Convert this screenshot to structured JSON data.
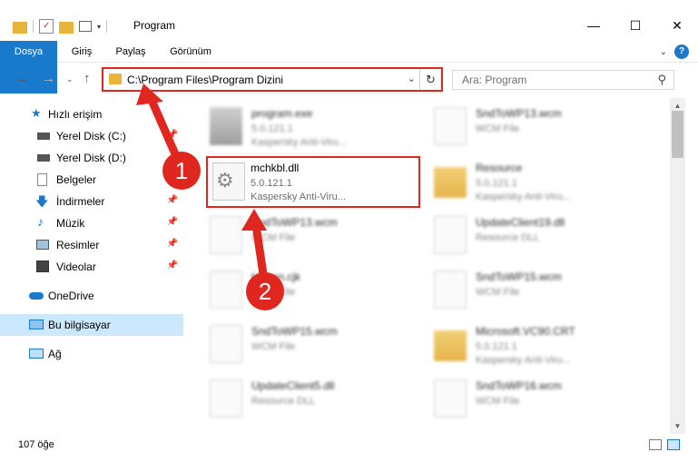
{
  "window": {
    "title": "Program"
  },
  "ribbon": {
    "tabs": [
      "Dosya",
      "Giriş",
      "Paylaş",
      "Görünüm"
    ]
  },
  "address": {
    "path": "C:\\Program Files\\Program Dizini"
  },
  "search": {
    "placeholder": "Ara: Program"
  },
  "sidebar": {
    "items": [
      {
        "label": "Hızlı erişim"
      },
      {
        "label": "Yerel Disk (C:)"
      },
      {
        "label": "Yerel Disk (D:)"
      },
      {
        "label": "Belgeler"
      },
      {
        "label": "İndirmeler"
      },
      {
        "label": "Müzik"
      },
      {
        "label": "Resimler"
      },
      {
        "label": "Videolar"
      },
      {
        "label": "OneDrive"
      },
      {
        "label": "Bu bilgisayar"
      },
      {
        "label": "Ağ"
      }
    ]
  },
  "files": [
    {
      "name": "program.exe",
      "line1": "5.0.121.1",
      "line2": "Kaspersky Anti-Viru..."
    },
    {
      "name": "SndToWP13.wcm",
      "line1": "WCM File",
      "line2": ""
    },
    {
      "name": "Resource",
      "line1": "5.0.121.1",
      "line2": "Kaspersky Anti-Viru..."
    },
    {
      "name": "SndToWP13.wcm",
      "line1": "WCM File",
      "line2": ""
    },
    {
      "name": "UpdateClient19.dll",
      "line1": "Resource DLL",
      "line2": ""
    },
    {
      "name": "kbman.cjk",
      "line1": "WCM File",
      "line2": ""
    },
    {
      "name": "SndToWP15.wcm",
      "line1": "WCM File",
      "line2": ""
    },
    {
      "name": "SndToWP15.wcm",
      "line1": "WCM File",
      "line2": ""
    },
    {
      "name": "Microsoft.VC90.CRT",
      "line1": "5.0.121.1",
      "line2": "Kaspersky Anti-Viru..."
    },
    {
      "name": "UpdateClient5.dll",
      "line1": "Resource DLL",
      "line2": ""
    },
    {
      "name": "SndToWP16.wcm",
      "line1": "WCM File",
      "line2": ""
    }
  ],
  "highlighted_file": {
    "name": "mchkbl.dll",
    "line1": "5.0.121.1",
    "line2": "Kaspersky Anti-Viru..."
  },
  "callouts": [
    "1",
    "2"
  ],
  "status": {
    "count": "107 öğe"
  },
  "colors": {
    "accent": "#1979ca",
    "highlight": "#e0271f",
    "selected": "#cce8ff"
  }
}
